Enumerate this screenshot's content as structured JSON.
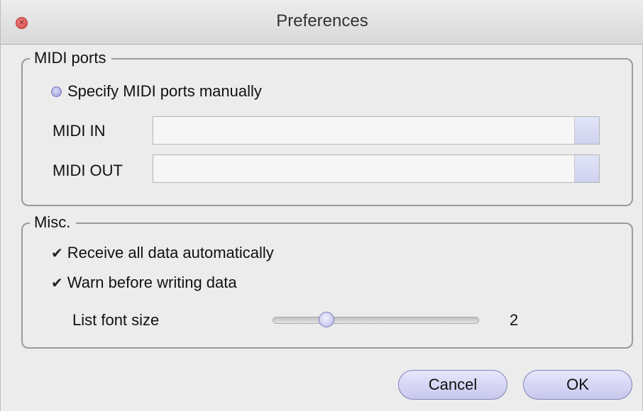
{
  "window": {
    "title": "Preferences"
  },
  "midi_ports": {
    "legend": "MIDI ports",
    "specify_manually_label": "Specify MIDI ports manually",
    "midi_in_label": "MIDI IN",
    "midi_in_value": "",
    "midi_out_label": "MIDI OUT",
    "midi_out_value": ""
  },
  "misc": {
    "legend": "Misc.",
    "receive_all_label": "Receive all data automatically",
    "receive_all_checked": true,
    "warn_before_label": "Warn before writing data",
    "warn_before_checked": true,
    "font_size_label": "List font size",
    "font_size_value": "2",
    "font_size_fraction": 0.26
  },
  "buttons": {
    "cancel_label": "Cancel",
    "ok_label": "OK"
  },
  "icons": {
    "close": "close-icon",
    "check": "checkmark-icon"
  }
}
